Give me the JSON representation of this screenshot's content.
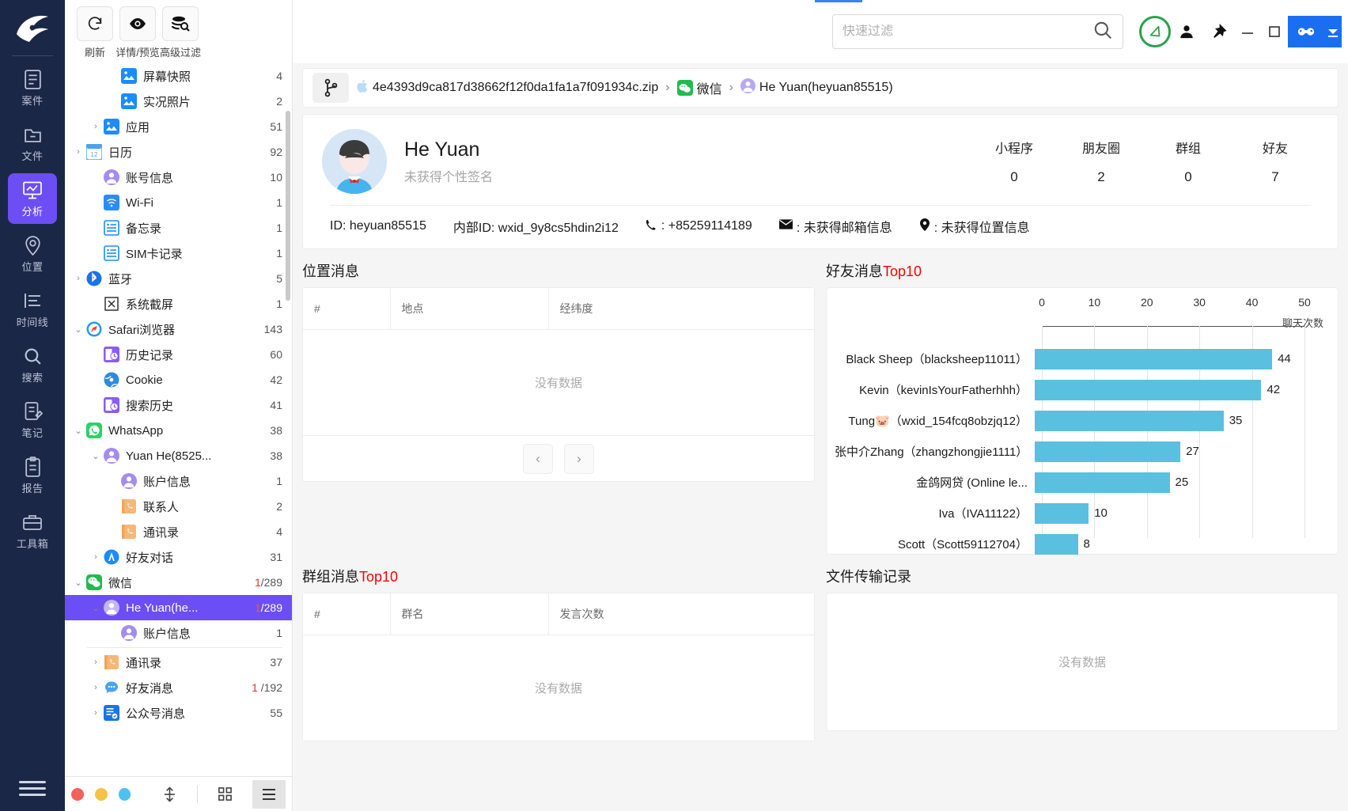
{
  "rail": {
    "items": [
      {
        "label": "案件",
        "icon": "case-icon",
        "active": false
      },
      {
        "label": "文件",
        "icon": "folder-icon",
        "active": false
      },
      {
        "label": "分析",
        "icon": "analysis-icon",
        "active": true
      },
      {
        "label": "位置",
        "icon": "location-icon",
        "active": false
      },
      {
        "label": "时间线",
        "icon": "timeline-icon",
        "active": false
      },
      {
        "label": "搜索",
        "icon": "search-icon",
        "active": false
      },
      {
        "label": "笔记",
        "icon": "note-icon",
        "active": false
      },
      {
        "label": "报告",
        "icon": "report-icon",
        "active": false
      },
      {
        "label": "工具箱",
        "icon": "toolbox-icon",
        "active": false
      }
    ]
  },
  "toolbar": {
    "buttons": [
      {
        "label": "刷新",
        "icon": "refresh-icon"
      },
      {
        "label": "详情/预览",
        "icon": "eye-icon"
      },
      {
        "label": "高级过滤",
        "icon": "advanced-filter-icon"
      }
    ]
  },
  "search": {
    "placeholder": "快速过滤",
    "value": ""
  },
  "tree": {
    "items": [
      {
        "arrow": "",
        "icon": "image-icon",
        "icon_color": "#1a8cff",
        "label": "屏幕快照",
        "count": "4",
        "indent": 2
      },
      {
        "arrow": "",
        "icon": "image-icon",
        "icon_color": "#1a8cff",
        "label": "实况照片",
        "count": "2",
        "indent": 2
      },
      {
        "arrow": "›",
        "icon": "image-icon",
        "icon_color": "#1a8cff",
        "label": "应用",
        "count": "51",
        "indent": 1
      },
      {
        "arrow": "›",
        "icon": "calendar-icon",
        "icon_color": "#4aa3f0",
        "label": "日历",
        "count": "92",
        "indent": 0
      },
      {
        "arrow": "",
        "icon": "account-icon",
        "icon_color": "#a48bf0",
        "label": "账号信息",
        "count": "10",
        "indent": 1
      },
      {
        "arrow": "",
        "icon": "wifi-icon",
        "icon_color": "#2b8cf5",
        "label": "Wi-Fi",
        "count": "1",
        "indent": 1
      },
      {
        "arrow": "",
        "icon": "memo-icon",
        "icon_color": "#1a8cff",
        "label": "备忘录",
        "count": "1",
        "indent": 1
      },
      {
        "arrow": "",
        "icon": "sim-icon",
        "icon_color": "#1a8cff",
        "label": "SIM卡记录",
        "count": "1",
        "indent": 1
      },
      {
        "arrow": "›",
        "icon": "bluetooth-icon",
        "icon_color": "#1a73e8",
        "label": "蓝牙",
        "count": "5",
        "indent": 0
      },
      {
        "arrow": "",
        "icon": "screenshot-icon",
        "icon_color": "#333333",
        "label": "系统截屏",
        "count": "1",
        "indent": 1
      },
      {
        "arrow": "⌄",
        "icon": "safari-icon",
        "icon_color": "#1f9cf0",
        "label": "Safari浏览器",
        "count": "143",
        "indent": 0
      },
      {
        "arrow": "",
        "icon": "history-icon",
        "icon_color": "#8b5cf6",
        "label": "历史记录",
        "count": "60",
        "indent": 1
      },
      {
        "arrow": "",
        "icon": "cookie-icon",
        "icon_color": "#2e8bd8",
        "label": "Cookie",
        "count": "42",
        "indent": 1
      },
      {
        "arrow": "",
        "icon": "history-icon",
        "icon_color": "#8b5cf6",
        "label": "搜索历史",
        "count": "41",
        "indent": 1
      },
      {
        "arrow": "⌄",
        "icon": "whatsapp-icon",
        "icon_color": "#25d366",
        "label": "WhatsApp",
        "count": "38",
        "indent": 0
      },
      {
        "arrow": "⌄",
        "icon": "account-icon",
        "icon_color": "#a48bf0",
        "label": "Yuan He(8525...",
        "count": "38",
        "indent": 1
      },
      {
        "arrow": "",
        "icon": "account-icon",
        "icon_color": "#a48bf0",
        "label": "账户信息",
        "count": "1",
        "indent": 2
      },
      {
        "arrow": "",
        "icon": "contact-icon",
        "icon_color": "#f5b878",
        "label": "联系人",
        "count": "2",
        "indent": 2
      },
      {
        "arrow": "",
        "icon": "contact-icon",
        "icon_color": "#f5b878",
        "label": "通讯录",
        "count": "4",
        "indent": 2
      },
      {
        "arrow": "›",
        "icon": "chat-app-icon",
        "icon_color": "#1a8cff",
        "label": "好友对话",
        "count": "31",
        "indent": 1
      },
      {
        "arrow": "⌄",
        "icon": "wechat-icon",
        "icon_color": "#1fbb4f",
        "label": "微信",
        "count": "1/289",
        "count_red": "1",
        "count_rest": "/289",
        "indent": 0
      },
      {
        "arrow": "⌄",
        "icon": "account-icon",
        "icon_color": "#c3b6f5",
        "label": "He Yuan(he...",
        "count": "1/289",
        "count_red": "1",
        "count_rest": "/289",
        "indent": 1,
        "selected": true
      },
      {
        "arrow": "",
        "icon": "account-icon",
        "icon_color": "#a48bf0",
        "label": "账户信息",
        "count": "1",
        "indent": 2
      },
      {
        "arrow": "›",
        "icon": "contact-icon",
        "icon_color": "#f5b878",
        "label": "通讯录",
        "count": "37",
        "indent": 1
      },
      {
        "arrow": "›",
        "icon": "message-icon",
        "icon_color": "#4aa3f0",
        "label": "好友消息",
        "count": "1 /192",
        "count_red": "1",
        "count_rest": " /192",
        "indent": 1
      },
      {
        "arrow": "›",
        "icon": "official-icon",
        "icon_color": "#1a73e8",
        "label": "公众号消息",
        "count": "55",
        "indent": 1
      }
    ]
  },
  "breadcrumb": {
    "zip": "4e4393d9ca817d38662f12f0da1fa1a7f091934c.zip",
    "app": "微信",
    "user": "He Yuan(heyuan85515)",
    "sep": "›"
  },
  "profile": {
    "name": "He Yuan",
    "signature": "未获得个性签名",
    "stats": [
      {
        "key": "小程序",
        "value": "0"
      },
      {
        "key": "朋友圈",
        "value": "2"
      },
      {
        "key": "群组",
        "value": "0"
      },
      {
        "key": "好友",
        "value": "7"
      }
    ],
    "meta": {
      "id": "ID: heyuan85515",
      "internal_id": "内部ID: wxid_9y8cs5hdin2i12",
      "phone": ": +85259114189",
      "email": ": 未获得邮箱信息",
      "location": ": 未获得位置信息"
    }
  },
  "location_panel": {
    "title": "位置消息",
    "columns": [
      "#",
      "地点",
      "经纬度"
    ],
    "empty_text": "没有数据",
    "prev": "‹",
    "next": "›"
  },
  "group_panel": {
    "title_prefix": "群组消息",
    "title_suffix": "Top10",
    "columns": [
      "#",
      "群名",
      "发言次数"
    ],
    "empty_text": "没有数据"
  },
  "file_panel": {
    "title": "文件传输记录",
    "empty_text": "没有数据"
  },
  "friend_panel": {
    "title_prefix": "好友消息",
    "title_suffix": "Top10"
  },
  "chart_data": {
    "type": "bar",
    "orientation": "horizontal",
    "title": "好友消息Top10",
    "xlabel": "聊天次数",
    "ylabel": "",
    "xlim": [
      0,
      50
    ],
    "xticks": [
      0,
      10,
      20,
      30,
      40,
      50
    ],
    "grid": true,
    "bar_color": "#59c0e0",
    "categories": [
      "Black Sheep（blacksheep11011）",
      "Kevin（kevinIsYourFatherhhh）",
      "Tung🐷（wxid_154fcq8obzjq12）",
      "张中介Zhang（zhangzhongjie1111）",
      "金鸽网贷 (Online le...",
      "Iva（IVA11122）",
      "Scott（Scott59112704）"
    ],
    "values": [
      44,
      42,
      35,
      27,
      25,
      10,
      8
    ]
  }
}
